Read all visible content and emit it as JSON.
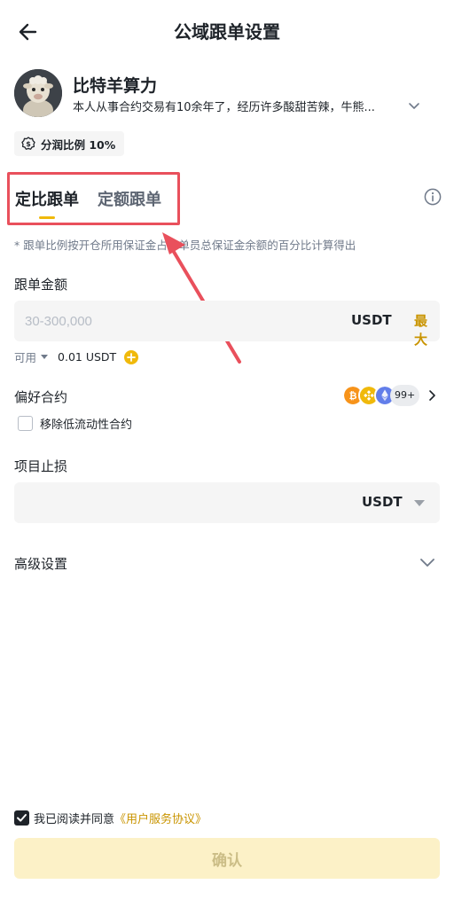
{
  "header": {
    "title": "公域跟单设置",
    "back_icon": "arrow-left-icon"
  },
  "trader": {
    "name": "比特羊算力",
    "bio": "本人从事合约交易有10余年了，经历许多酸甜苦辣，牛熊...",
    "expand_icon": "chevron-down-icon"
  },
  "profit_share": {
    "label": "分润比例 10%",
    "icon": "dollar-gear-icon"
  },
  "tabs": [
    {
      "label": "定比跟单",
      "active": true
    },
    {
      "label": "定额跟单",
      "active": false
    }
  ],
  "note": "* 跟单比例按开仓所用保证金占带单员总保证金余额的百分比计算得出",
  "copy_amount": {
    "label": "跟单金额",
    "placeholder": "30-300,000",
    "unit": "USDT",
    "max_label": "最大"
  },
  "available": {
    "label": "可用",
    "value": "0.01 USDT"
  },
  "preferred_contracts": {
    "label": "偏好合约",
    "more_count": "99+",
    "coins": [
      "btc-coin-icon",
      "bnb-coin-icon",
      "eth-coin-icon"
    ]
  },
  "remove_low_liquidity": {
    "label": "移除低流动性合约",
    "checked": false
  },
  "stop_loss": {
    "label": "项目止损",
    "unit": "USDT"
  },
  "advanced": {
    "label": "高级设置"
  },
  "agreement": {
    "text": "我已阅读并同意",
    "link": "《用户服务协议》",
    "checked": true
  },
  "confirm": {
    "label": "确认"
  },
  "colors": {
    "accent": "#f0b90b",
    "link": "#c99400",
    "highlight_box": "#e9505c"
  }
}
